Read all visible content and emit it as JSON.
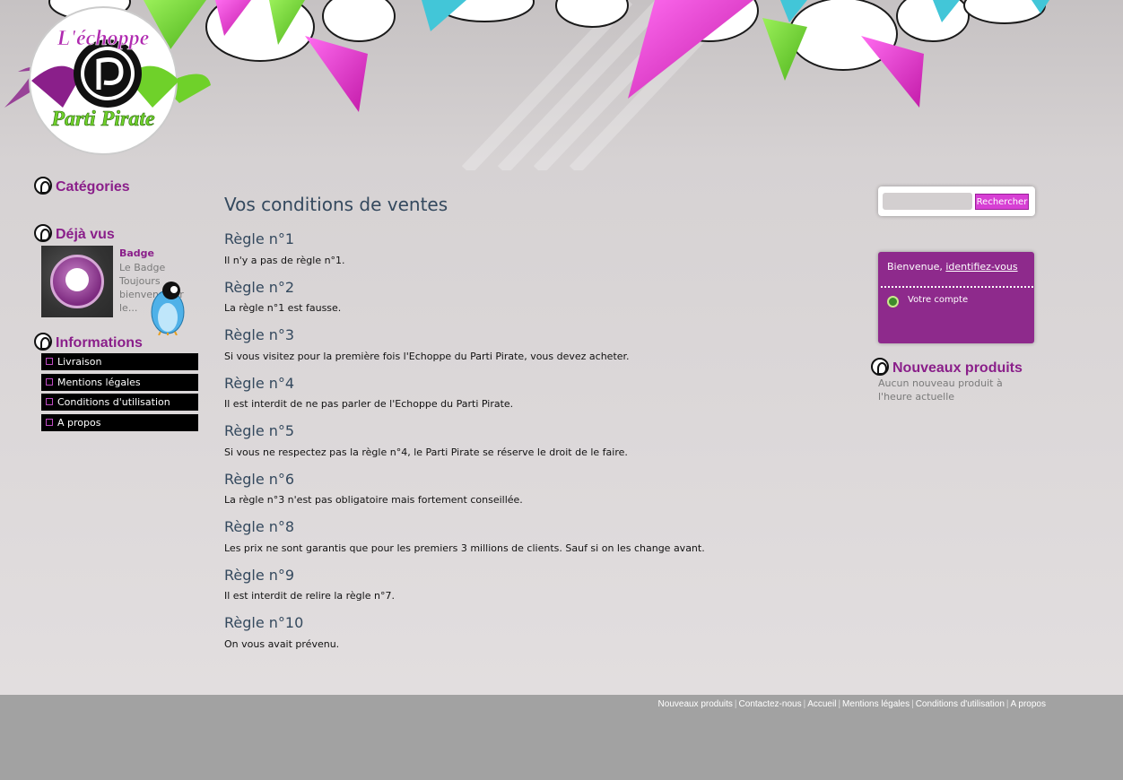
{
  "logo": {
    "line1": "L'échoppe",
    "line2": "Parti Pirate"
  },
  "sidebar": {
    "categories_title": "Catégories",
    "seen_title": "Déjà vus",
    "seen_item": {
      "name": "Badge",
      "desc": "Le Badge Toujours bienvenu sur le..."
    },
    "info_title": "Informations",
    "info_items": [
      "Livraison",
      "Mentions légales",
      "Conditions d'utilisation",
      "A propos"
    ]
  },
  "main": {
    "title": "Vos conditions de ventes",
    "rules": [
      {
        "title": "Règle n°1",
        "text": "Il n'y a pas de règle n°1."
      },
      {
        "title": "Règle n°2",
        "text": "La règle n°1 est fausse."
      },
      {
        "title": "Règle n°3",
        "text": "Si vous visitez pour la première fois l'Echoppe du Parti Pirate, vous devez acheter."
      },
      {
        "title": "Règle n°4",
        "text": "Il est interdit de ne pas parler de l'Echoppe du Parti Pirate."
      },
      {
        "title": "Règle n°5",
        "text": "Si vous ne respectez pas la règle n°4, le Parti Pirate se réserve le droit de le faire."
      },
      {
        "title": "Règle n°6",
        "text": "La règle n°3 n'est pas obligatoire mais fortement conseillée."
      },
      {
        "title": "Règle n°8",
        "text": "Les prix ne sont garantis que pour les premiers 3 millions de clients. Sauf si on les change avant."
      },
      {
        "title": "Règle n°9",
        "text": "Il est interdit de relire la règle n°7."
      },
      {
        "title": "Règle n°10",
        "text": "On vous avait prévenu."
      }
    ]
  },
  "search": {
    "placeholder": "",
    "button": "Rechercher"
  },
  "account": {
    "welcome": "Bienvenue,",
    "login_link": "identifiez-vous",
    "account_link": "Votre compte"
  },
  "new_products": {
    "title": "Nouveaux produits",
    "text": "Aucun nouveau produit à l'heure actuelle"
  },
  "footer": {
    "links": [
      "Nouveaux produits",
      "Contactez-nous",
      "Accueil",
      "Mentions légales",
      "Conditions d'utilisation",
      "A propos"
    ]
  },
  "colors": {
    "accent": "#8a1f8a",
    "pink": "#e63fd6",
    "green": "#6fd12a",
    "cyan": "#42c6d8",
    "footer": "#a2a2a2"
  }
}
